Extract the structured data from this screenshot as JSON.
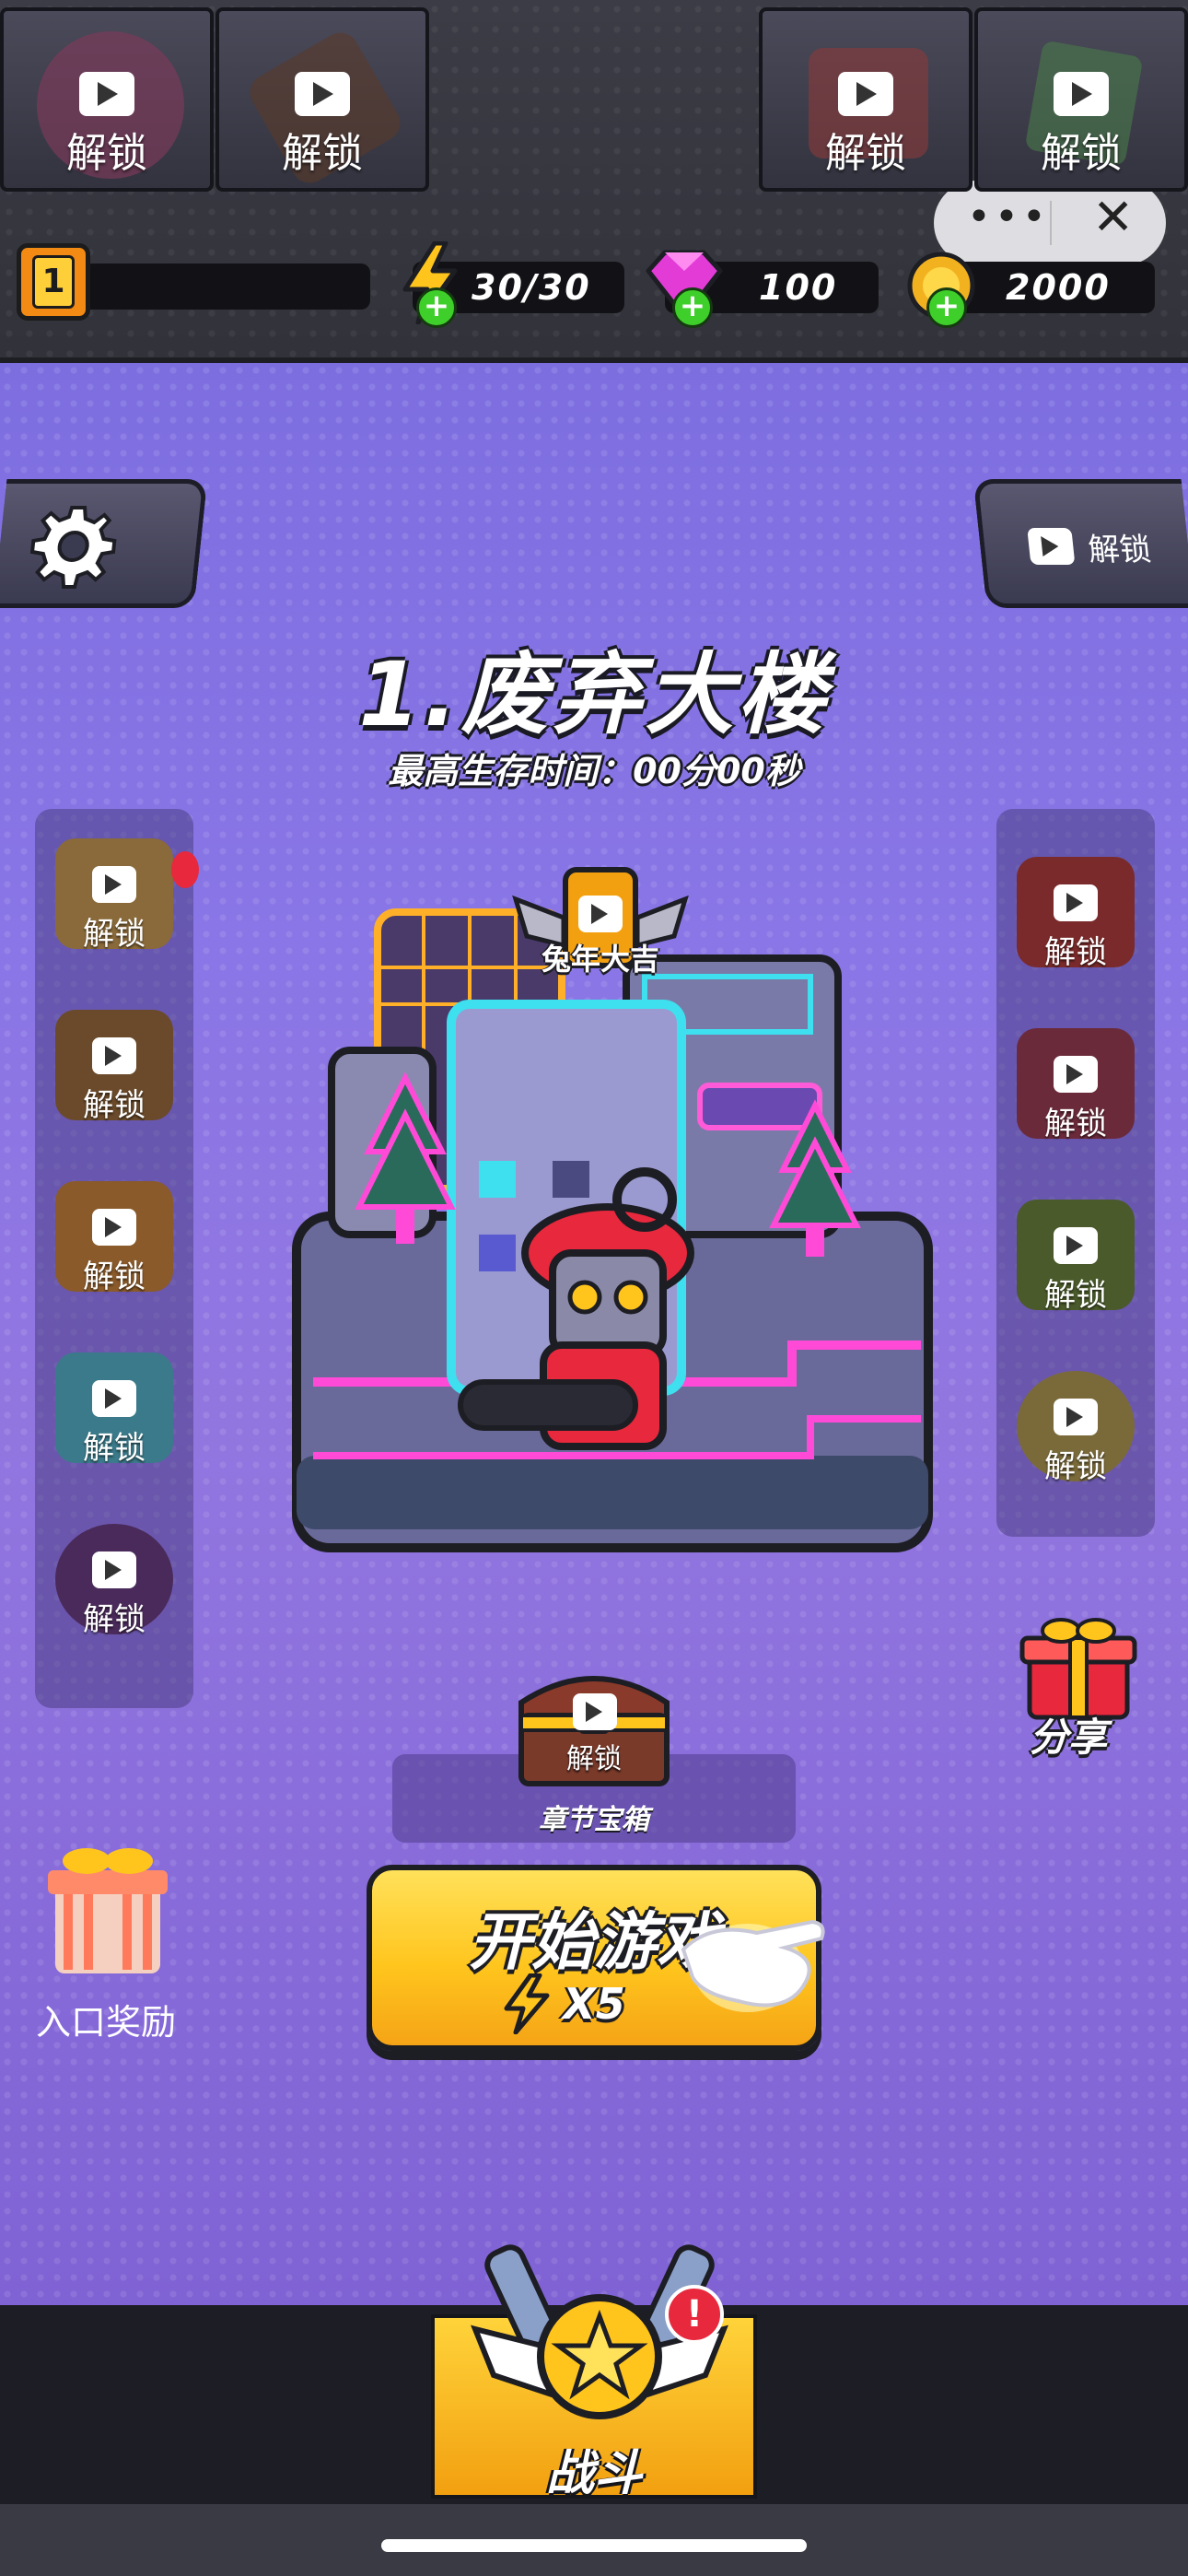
{
  "topbar": {
    "level": "1",
    "energy": "30/30",
    "gems": "100",
    "coins": "2000"
  },
  "capsule": {
    "more_glyph": "•••",
    "close_glyph": "✕"
  },
  "level": {
    "title": "1.废弃大楼",
    "best_time": "最高生存时间：00分00秒"
  },
  "common": {
    "unlock": "解锁"
  },
  "left_menu": [
    {
      "name": "签到",
      "label": "解锁"
    },
    {
      "name": "快巡",
      "label": "解锁"
    },
    {
      "name": "任务",
      "label": "解锁"
    },
    {
      "name": "猜拳",
      "label": "解锁"
    },
    {
      "name": "挂机",
      "label": "解锁"
    }
  ],
  "right_menu": [
    {
      "name": "衣橱",
      "label": "解锁"
    },
    {
      "name": "英雄",
      "label": "解锁"
    },
    {
      "name": "宝箱",
      "label": "解锁"
    },
    {
      "name": "特权",
      "label": "解锁"
    }
  ],
  "event_badge": {
    "name": "兔年大吉",
    "label": ""
  },
  "share": {
    "label": "分享"
  },
  "entrance_reward": {
    "label": "入口奖励"
  },
  "chapter_chest": {
    "unlock": "解锁",
    "label": "章节宝箱"
  },
  "start": {
    "label": "开始游戏",
    "cost": "X5"
  },
  "bottom_nav": [
    {
      "label": "解锁"
    },
    {
      "label": "解锁"
    },
    {
      "label": "战斗",
      "active": true
    },
    {
      "label": "解锁"
    },
    {
      "label": "解锁"
    }
  ],
  "colors": {
    "bg_purple": "#8a76e6",
    "start_yellow": "#ffc51d",
    "plus_green": "#3fcf2a",
    "badge_red": "#e8283c"
  }
}
